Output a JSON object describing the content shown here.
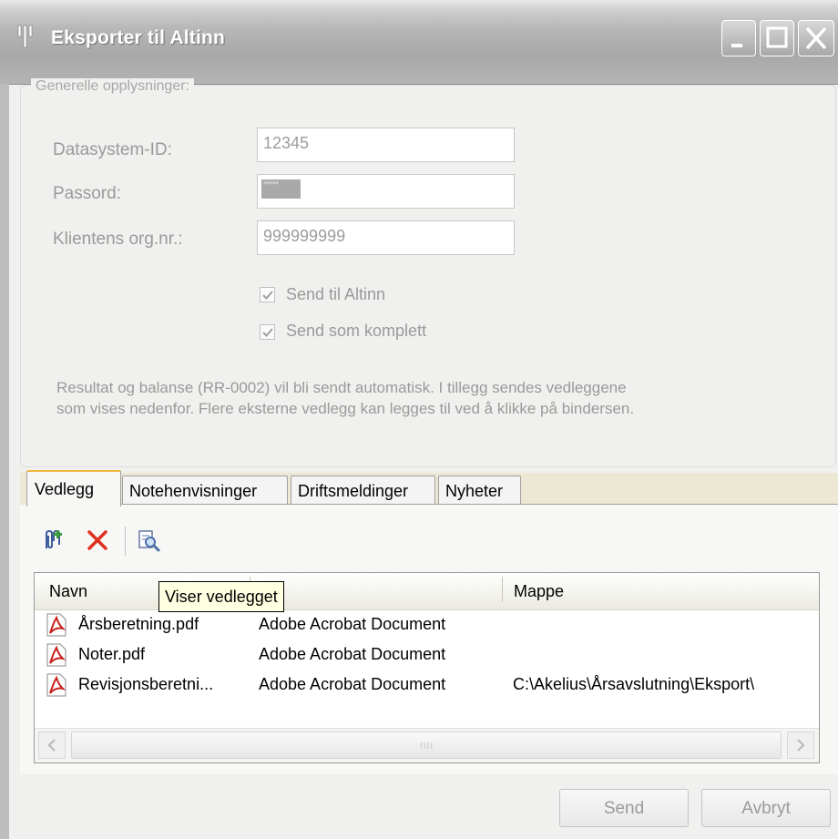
{
  "window": {
    "title": "Eksporter til Altinn"
  },
  "general": {
    "legend": "Generelle opplysninger:",
    "datasystem_label": "Datasystem-ID:",
    "datasystem_value": "12345",
    "password_label": "Passord:",
    "password_value": "*****",
    "client_label": "Klientens org.nr.:",
    "client_value": "999999999",
    "send_altinn_label": "Send til Altinn",
    "send_altinn_checked": true,
    "send_complete_label": "Send som komplett",
    "send_complete_checked": true,
    "info_line1": "Resultat og balanse (RR-0002) vil bli sendt automatisk. I tillegg sendes vedleggene",
    "info_line2": "som vises nedenfor. Flere eksterne vedlegg kan legges til ved å klikke på bindersen."
  },
  "tabs": [
    {
      "label": "Vedlegg",
      "active": true
    },
    {
      "label": "Notehenvisninger",
      "active": false
    },
    {
      "label": "Driftsmeldinger",
      "active": false
    },
    {
      "label": "Nyheter",
      "active": false
    }
  ],
  "toolbar": {
    "icons": [
      "attach-add-icon",
      "delete-icon",
      "preview-icon"
    ]
  },
  "list": {
    "columns": [
      "Navn",
      "Mappe"
    ],
    "rows": [
      {
        "name": "Årsberetning.pdf",
        "type": "Adobe Acrobat Document",
        "folder": ""
      },
      {
        "name": "Noter.pdf",
        "type": "Adobe Acrobat Document",
        "folder": ""
      },
      {
        "name": "Revisjonsberetni...",
        "type": "Adobe Acrobat Document",
        "folder": "C:\\Akelius\\Årsavslutning\\Eksport\\"
      }
    ],
    "scroll_grip": "IIII"
  },
  "tooltip": "Viser vedlegget",
  "buttons": {
    "send": "Send",
    "cancel": "Avbryt"
  },
  "colors": {
    "active_tab_accent": "#f2b640",
    "delete_red": "#e03020",
    "pdf_red": "#c8201c"
  }
}
